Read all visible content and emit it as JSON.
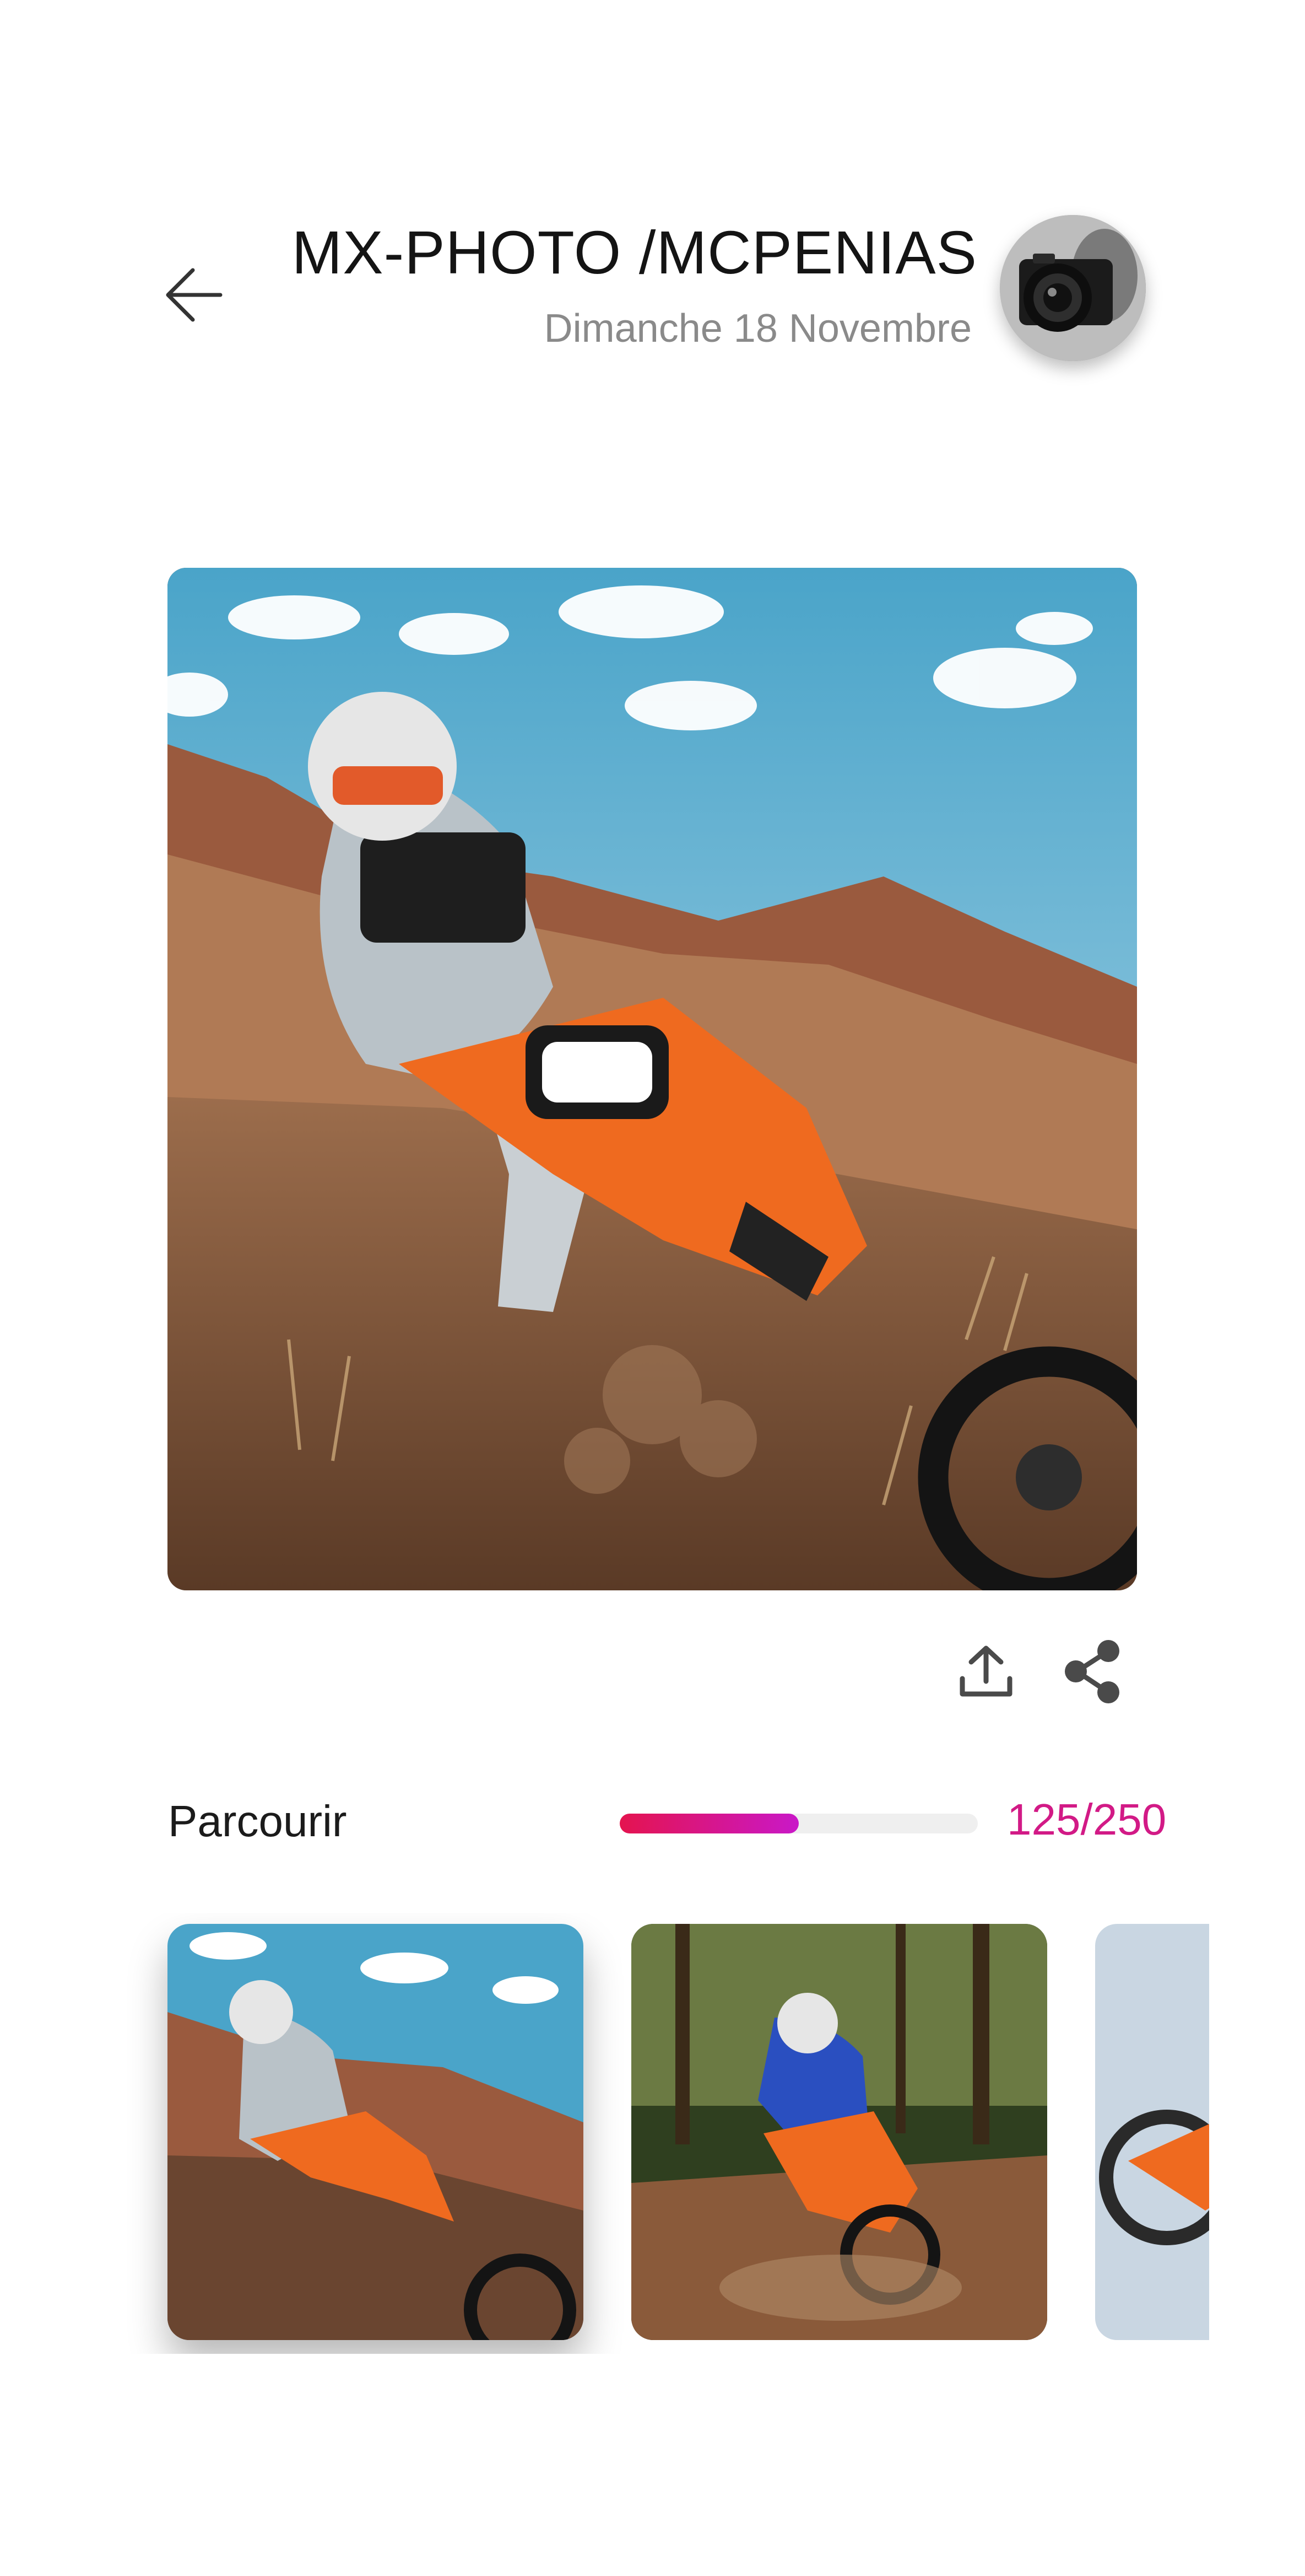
{
  "header": {
    "title": "MX-PHOTO /MCPENIAS",
    "date": "Dimanche 18 Novembre",
    "icons": {
      "back": "arrow-left-icon",
      "avatar": "camera-photographer-avatar"
    }
  },
  "actions": {
    "upload_icon": "upload-icon",
    "share_icon": "share-icon"
  },
  "browse": {
    "label": "Parcourir",
    "current": 125,
    "total": 250,
    "count_text": "125/250",
    "progress": 0.5
  },
  "thumbnails": [
    {
      "desc": "rider-316-orange-bike",
      "selected": true
    },
    {
      "desc": "rider-19-forest-track",
      "selected": false
    },
    {
      "desc": "bike-jump-sky",
      "selected": false
    }
  ],
  "colors": {
    "accent_start": "#e4144f",
    "accent_end": "#c918c8",
    "count_text": "#d21a86",
    "subtitle": "#8a8a8a",
    "title": "#141414"
  }
}
